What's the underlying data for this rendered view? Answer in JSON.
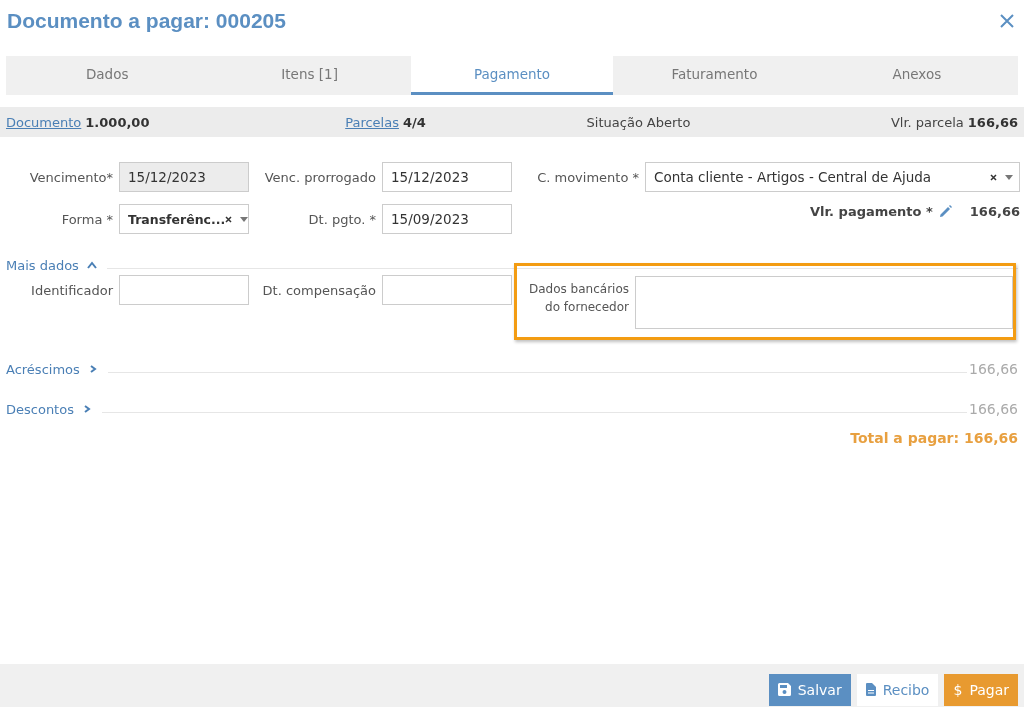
{
  "window": {
    "title": "Documento a pagar: 000205"
  },
  "tabs": [
    {
      "label": "Dados",
      "selected": false
    },
    {
      "label": "Itens [1]",
      "selected": false
    },
    {
      "label": "Pagamento",
      "selected": true
    },
    {
      "label": "Faturamento",
      "selected": false
    },
    {
      "label": "Anexos",
      "selected": false
    }
  ],
  "summary": [
    {
      "label": "Documento",
      "value": "1.000,00",
      "link": true,
      "bold": true
    },
    {
      "label": "Parcelas",
      "value": "4/4",
      "link": true,
      "bold": true
    },
    {
      "label": "Situação",
      "value": "Aberto",
      "link": false,
      "bold": false
    },
    {
      "label": "Vlr. parcela",
      "value": "166,66",
      "link": false,
      "bold": true
    }
  ],
  "fields": {
    "vencimento": {
      "label": "Vencimento*",
      "value": "15/12/2023",
      "disabled": true
    },
    "venc_prorrogado": {
      "label": "Venc. prorrogado",
      "value": "15/12/2023",
      "disabled": false
    },
    "c_movimento": {
      "label": "C. movimento *",
      "value": "Conta cliente - Artigos - Central de Ajuda"
    },
    "forma": {
      "label": "Forma *",
      "value": "Transferênc..."
    },
    "dt_pgto": {
      "label": "Dt. pgto. *",
      "value": "15/09/2023",
      "disabled": false
    },
    "vlr_pagamento": {
      "label": "Vlr. pagamento *",
      "value": "166,66"
    }
  },
  "mais_dados": {
    "title": "Mais dados",
    "expanded": true,
    "fields": [
      {
        "label": "Identificador"
      },
      {
        "label": "Dt. compensação"
      }
    ],
    "dados_bancarios": {
      "label_lines": [
        "Dados bancários",
        "do fornecedor"
      ],
      "highlighted": true
    }
  },
  "sections": [
    {
      "title": "Acréscimos",
      "expanded": false,
      "value": "166,66"
    },
    {
      "title": "Descontos",
      "expanded": false,
      "value": "166,66"
    }
  ],
  "total": "Total a pagar: 166,66",
  "buttons": [
    {
      "label": "Salvar",
      "kind": "save"
    },
    {
      "label": "Recibo",
      "kind": "receipt"
    },
    {
      "label": "Pagar",
      "kind": "pay",
      "icon": "$"
    }
  ]
}
